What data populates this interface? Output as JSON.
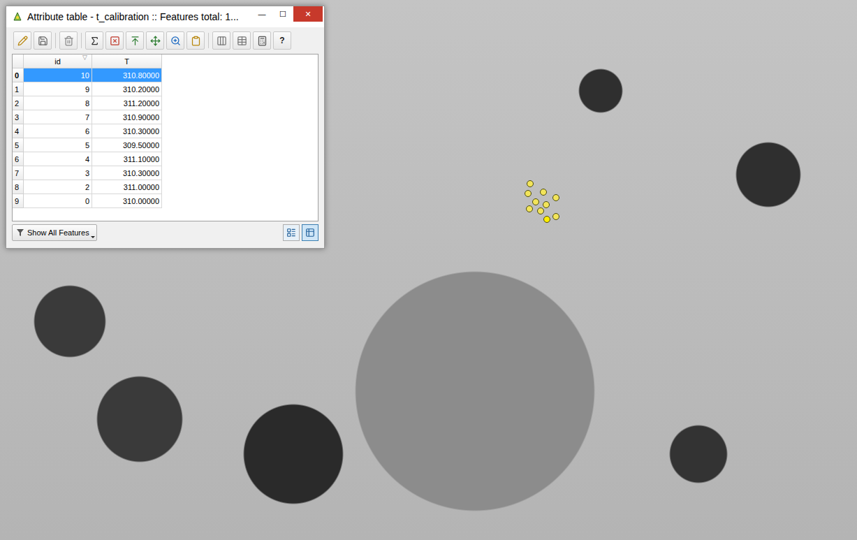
{
  "window": {
    "title": "Attribute table - t_calibration :: Features total: 1...",
    "controls": [
      {
        "label": "—",
        "kind": "minimize"
      },
      {
        "label": "☐",
        "kind": "maximize"
      },
      {
        "label": "✕",
        "kind": "close"
      }
    ]
  },
  "toolbar": {
    "help_label": "?"
  },
  "table": {
    "columns": [
      {
        "label": "id",
        "sort_indicator": "▽",
        "sorted": true
      },
      {
        "label": "T",
        "sort_indicator": "",
        "sorted": false
      }
    ],
    "rows": [
      {
        "row": "0",
        "id": "10",
        "T": "310.80000",
        "selected": true
      },
      {
        "row": "1",
        "id": "9",
        "T": "310.20000",
        "selected": false
      },
      {
        "row": "2",
        "id": "8",
        "T": "311.20000",
        "selected": false
      },
      {
        "row": "3",
        "id": "7",
        "T": "310.90000",
        "selected": false
      },
      {
        "row": "4",
        "id": "6",
        "T": "310.30000",
        "selected": false
      },
      {
        "row": "5",
        "id": "5",
        "T": "309.50000",
        "selected": false
      },
      {
        "row": "6",
        "id": "4",
        "T": "311.10000",
        "selected": false
      },
      {
        "row": "7",
        "id": "3",
        "T": "310.30000",
        "selected": false
      },
      {
        "row": "8",
        "id": "2",
        "T": "311.00000",
        "selected": false
      },
      {
        "row": "9",
        "id": "0",
        "T": "310.00000",
        "selected": false
      }
    ]
  },
  "footer": {
    "filter_button": "Show All Features",
    "view_modes": [
      {
        "kind": "form",
        "selected": false
      },
      {
        "kind": "table",
        "selected": true
      }
    ]
  },
  "map": {
    "points": [
      {
        "selected": false
      },
      {
        "selected": false
      },
      {
        "selected": false
      },
      {
        "selected": false
      },
      {
        "selected": false
      },
      {
        "selected": false
      },
      {
        "selected": false
      },
      {
        "selected": false
      },
      {
        "selected": false
      },
      {
        "selected": true
      }
    ]
  }
}
